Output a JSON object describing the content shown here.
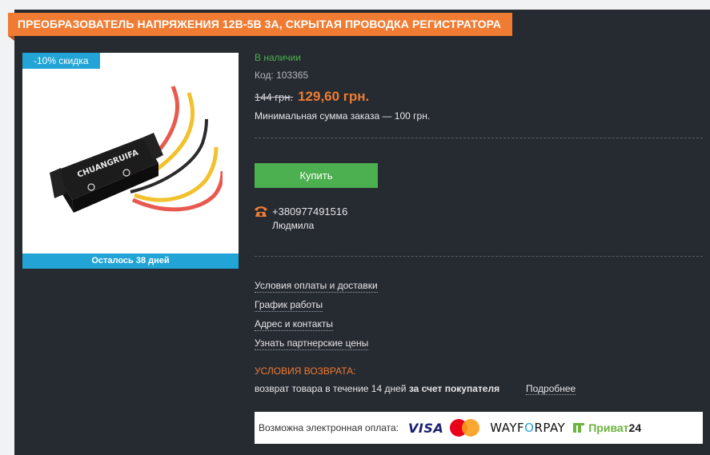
{
  "product": {
    "title": "ПРЕОБРАЗОВАТЕЛЬ НАПРЯЖЕНИЯ 12В-5В 3А, СКРЫТАЯ ПРОВОДКА РЕГИСТРАТОРА",
    "discount_badge": "-10% скидка",
    "remaining": "Осталось 38 дней",
    "image_icon": "dc-converter-photo",
    "stock": "В наличии",
    "code": "Код: 103365",
    "old_price": "144 грн.",
    "new_price": "129,60 грн.",
    "min_order": "Минимальная сумма заказа — 100 грн."
  },
  "actions": {
    "buy_label": "Купить"
  },
  "contact": {
    "phone_icon": "phone-icon",
    "phone": "+380977491516",
    "name": "Людмила"
  },
  "links": [
    "Условия оплаты и доставки",
    "График работы",
    "Адрес и контакты",
    "Узнать партнерские цены"
  ],
  "returns": {
    "title": "УСЛОВИЯ ВОЗВРАТА:",
    "text": "возврат товара в течение 14 дней",
    "text_bold": "за счет покупателя",
    "more": "Подробнее"
  },
  "payment": {
    "label": "Возможна электронная оплата:",
    "visa": "VISA",
    "wayforpay_a": "WAYF",
    "wayforpay_b": "O",
    "wayforpay_c": "RPAY",
    "privat_a": "Приват",
    "privat_b": "24"
  },
  "colors": {
    "accent": "#f07c33",
    "panel": "#262a31",
    "buy": "#4caf50",
    "badge": "#22a5d6"
  }
}
